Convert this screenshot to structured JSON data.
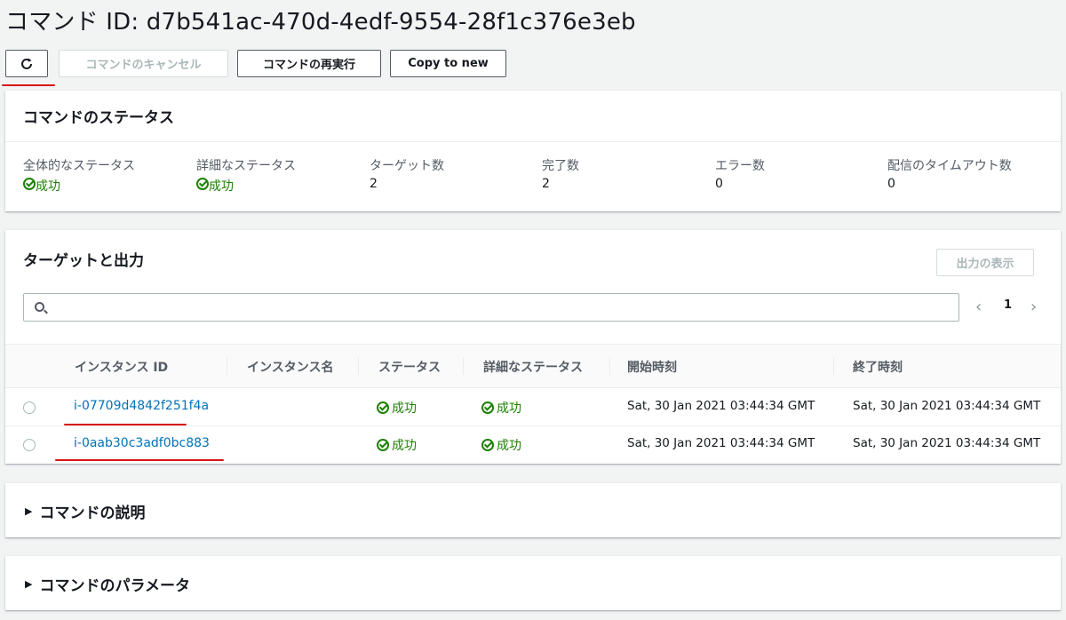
{
  "title": "コマンド ID: d7b541ac-470d-4edf-9554-28f1c376e3eb",
  "toolbar": {
    "refresh_icon": "refresh-icon",
    "cancel_label": "コマンドのキャンセル",
    "rerun_label": "コマンドの再実行",
    "copy_label": "Copy to new"
  },
  "status_panel": {
    "heading": "コマンドのステータス",
    "stats": [
      {
        "label": "全体的なステータス",
        "value": "成功",
        "type": "status"
      },
      {
        "label": "詳細なステータス",
        "value": "成功",
        "type": "status"
      },
      {
        "label": "ターゲット数",
        "value": "2",
        "type": "text"
      },
      {
        "label": "完了数",
        "value": "2",
        "type": "text"
      },
      {
        "label": "エラー数",
        "value": "0",
        "type": "text"
      },
      {
        "label": "配信のタイムアウト数",
        "value": "0",
        "type": "text"
      }
    ]
  },
  "targets_panel": {
    "heading": "ターゲットと出力",
    "show_output_label": "出力の表示",
    "search_placeholder": "",
    "page": "1",
    "prev_glyph": "‹",
    "next_glyph": "›",
    "columns": [
      "インスタンス ID",
      "インスタンス名",
      "ステータス",
      "詳細なステータス",
      "開始時刻",
      "終了時刻"
    ],
    "rows": [
      {
        "instance_id": "i-07709d4842f251f4a",
        "instance_name": "",
        "status": "成功",
        "detailed_status": "成功",
        "start": "Sat, 30 Jan 2021 03:44:34 GMT",
        "end": "Sat, 30 Jan 2021 03:44:34 GMT"
      },
      {
        "instance_id": "i-0aab30c3adf0bc883",
        "instance_name": "",
        "status": "成功",
        "detailed_status": "成功",
        "start": "Sat, 30 Jan 2021 03:44:34 GMT",
        "end": "Sat, 30 Jan 2021 03:44:34 GMT"
      }
    ]
  },
  "description_panel": {
    "caret": "▶",
    "heading": "コマンドの説明"
  },
  "parameters_panel": {
    "caret": "▶",
    "heading": "コマンドのパラメータ"
  },
  "colors": {
    "success": "#1d8102",
    "link": "#0073bb",
    "highlight": "#d91515"
  }
}
